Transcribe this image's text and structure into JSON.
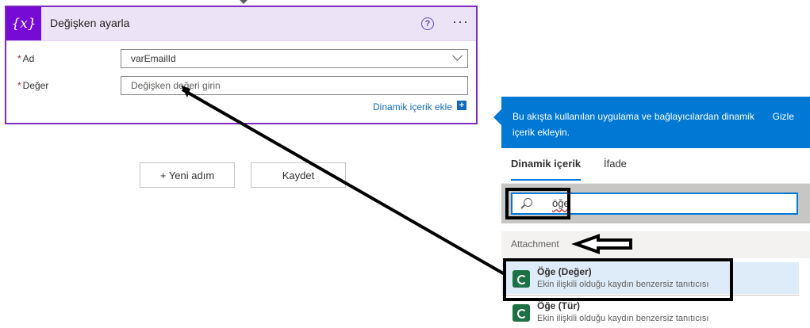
{
  "card": {
    "icon_text": "{x}",
    "title": "Değişken ayarla",
    "help_icon": "question-icon",
    "more_icon": "more-horizontal-icon",
    "fields": [
      {
        "label": "Ad",
        "required": "*",
        "value": "varEmailId"
      },
      {
        "label": "Değer",
        "required": "*",
        "placeholder": "Değişken değeri girin"
      }
    ],
    "dynamic_link": "Dinamik içerik ekle",
    "dynamic_plus": "+"
  },
  "buttons": {
    "new_step": "+ Yeni adım",
    "save": "Kaydet"
  },
  "panel": {
    "description": "Bu akışta kullanılan uygulama ve bağlayıcılardan dinamik içerik ekleyin.",
    "hide": "Gizle",
    "tabs": [
      "Dinamik içerik",
      "İfade"
    ],
    "search_value": "öğe",
    "section": "Attachment",
    "items": [
      {
        "title": "Öğe (Değer)",
        "desc": "Ekin ilişkili olduğu kaydın benzersiz tanıtıcısı"
      },
      {
        "title": "Öğe (Tür)",
        "desc": "Ekin ilişkili olduğu kaydın benzersiz tanıtıcısı"
      }
    ]
  },
  "colors": {
    "accent_purple": "#770bd6",
    "card_border": "#7e2cbf",
    "panel_blue": "#0078d4",
    "item_icon": "#1e7145"
  }
}
